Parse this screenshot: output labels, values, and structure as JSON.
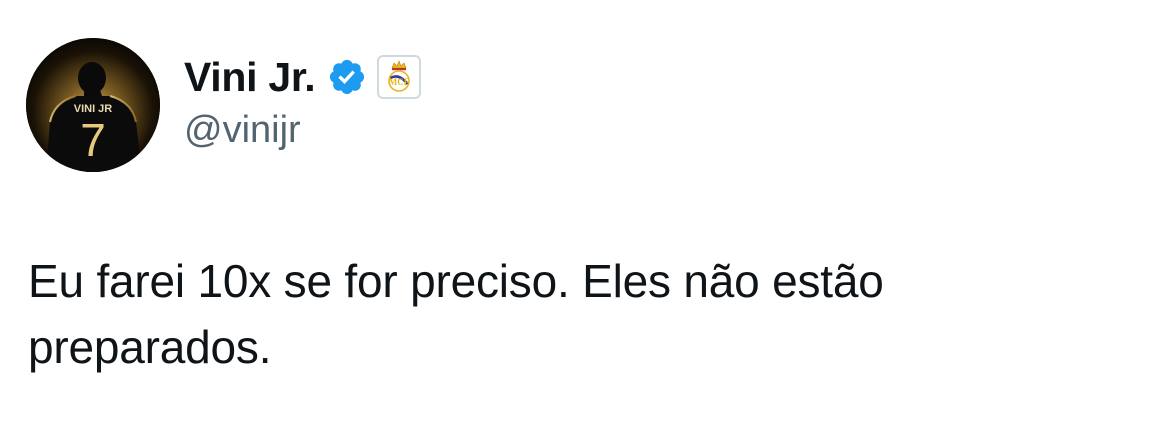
{
  "author": {
    "display_name": "Vini Jr.",
    "handle": "@vinijr",
    "avatar_jersey_name": "VINI JR",
    "avatar_jersey_number": "7",
    "verified_color": "#1d9bf0",
    "verified_icon": "verified-badge-icon",
    "affiliation_icon": "real-madrid-crest-icon"
  },
  "tweet": {
    "text": "Eu farei 10x se for preciso. Eles não estão preparados."
  }
}
